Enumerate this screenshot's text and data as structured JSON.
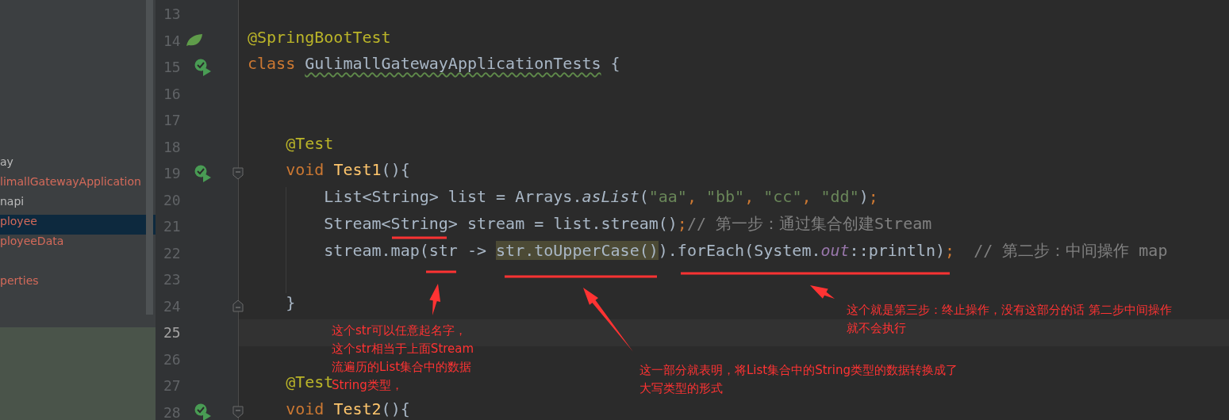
{
  "project_tree": {
    "items": [
      {
        "label": "ay",
        "color": "#bbbbbb",
        "selected": false
      },
      {
        "label": "limallGatewayApplication",
        "color": "#d46a5a",
        "selected": false
      },
      {
        "label": "napi",
        "color": "#bbbbbb",
        "selected": false
      },
      {
        "label": "ployee",
        "color": "#d46a5a",
        "selected": true
      },
      {
        "label": "ployeeData",
        "color": "#d46a5a",
        "selected": false
      },
      {
        "label": "perties",
        "color": "#d46a5a",
        "selected": false
      }
    ]
  },
  "editor": {
    "lines": [
      {
        "number": "13",
        "current": false
      },
      {
        "number": "14",
        "current": false,
        "gutter": {
          "kind": "spring"
        },
        "tokens": [
          {
            "text": "@SpringBootTest",
            "kind": "annotation"
          }
        ]
      },
      {
        "number": "15",
        "current": false,
        "gutter": {
          "kind": "run"
        },
        "tokens": [
          {
            "text": "class ",
            "kind": "keyword"
          },
          {
            "text": "GulimallGatewayApplicationTests",
            "kind": "typo"
          },
          {
            "text": " {",
            "kind": "plain"
          }
        ]
      },
      {
        "number": "16",
        "current": false
      },
      {
        "number": "17",
        "current": false
      },
      {
        "number": "18",
        "current": false,
        "tokens": [
          {
            "text": "    @Test",
            "kind": "annotation"
          }
        ]
      },
      {
        "number": "19",
        "current": false,
        "gutter": {
          "kind": "run"
        },
        "fold": {
          "kind": "start"
        },
        "tokens": [
          {
            "text": "    void ",
            "kind": "keyword"
          },
          {
            "text": "Test1",
            "kind": "method"
          },
          {
            "text": "(){",
            "kind": "plain"
          }
        ]
      },
      {
        "number": "20",
        "current": false,
        "tokens": [
          {
            "text": "        List<String> list = Arrays.",
            "kind": "plain"
          },
          {
            "text": "asList",
            "kind": "static"
          },
          {
            "text": "(",
            "kind": "plain"
          },
          {
            "text": "\"aa\"",
            "kind": "string"
          },
          {
            "text": ", ",
            "kind": "keyword"
          },
          {
            "text": "\"bb\"",
            "kind": "string"
          },
          {
            "text": ", ",
            "kind": "keyword"
          },
          {
            "text": "\"cc\"",
            "kind": "string"
          },
          {
            "text": ", ",
            "kind": "keyword"
          },
          {
            "text": "\"dd\"",
            "kind": "string"
          },
          {
            "text": ")",
            "kind": "plain"
          },
          {
            "text": ";",
            "kind": "keyword"
          }
        ]
      },
      {
        "number": "21",
        "current": false,
        "tokens": [
          {
            "text": "        Stream<String> stream = list.stream()",
            "kind": "plain"
          },
          {
            "text": ";",
            "kind": "keyword"
          },
          {
            "text": "// 第一步：通过集合创建Stream",
            "kind": "comment"
          }
        ]
      },
      {
        "number": "22",
        "current": false,
        "tokens": [
          {
            "text": "        stream.map(str -> ",
            "kind": "plain"
          },
          {
            "text": "str.toUpperCase()",
            "kind": "highlight"
          },
          {
            "text": ").forEach(System.",
            "kind": "plain"
          },
          {
            "text": "out",
            "kind": "field"
          },
          {
            "text": "::println)",
            "kind": "plain"
          },
          {
            "text": ";",
            "kind": "keyword"
          },
          {
            "text": "  // 第二步：中间操作 map",
            "kind": "comment"
          }
        ]
      },
      {
        "number": "23",
        "current": false
      },
      {
        "number": "24",
        "current": false,
        "fold": {
          "kind": "end"
        },
        "tokens": [
          {
            "text": "    }",
            "kind": "plain"
          }
        ]
      },
      {
        "number": "25",
        "current": true
      },
      {
        "number": "26",
        "current": false
      },
      {
        "number": "27",
        "current": false,
        "tokens": [
          {
            "text": "    @Test",
            "kind": "annotation"
          }
        ]
      },
      {
        "number": "28",
        "current": false,
        "gutter": {
          "kind": "run"
        },
        "fold": {
          "kind": "start"
        },
        "tokens": [
          {
            "text": "    void ",
            "kind": "keyword"
          },
          {
            "text": "Test2",
            "kind": "method"
          },
          {
            "text": "(){",
            "kind": "plain"
          }
        ]
      }
    ]
  },
  "notes": [
    {
      "lines": [
        "这个str可以任意起名字，",
        "这个str相当于上面Stream",
        "流遍历的List集合中的数据",
        "String类型，"
      ]
    },
    {
      "lines": [
        "这一部分就表明，将List集合中的String类型的数据转换成了",
        "大写类型的形式"
      ]
    },
    {
      "lines": [
        "这个就是第三步：终止操作，没有这部分的话 第二步中间操作",
        "就不会执行"
      ]
    }
  ]
}
